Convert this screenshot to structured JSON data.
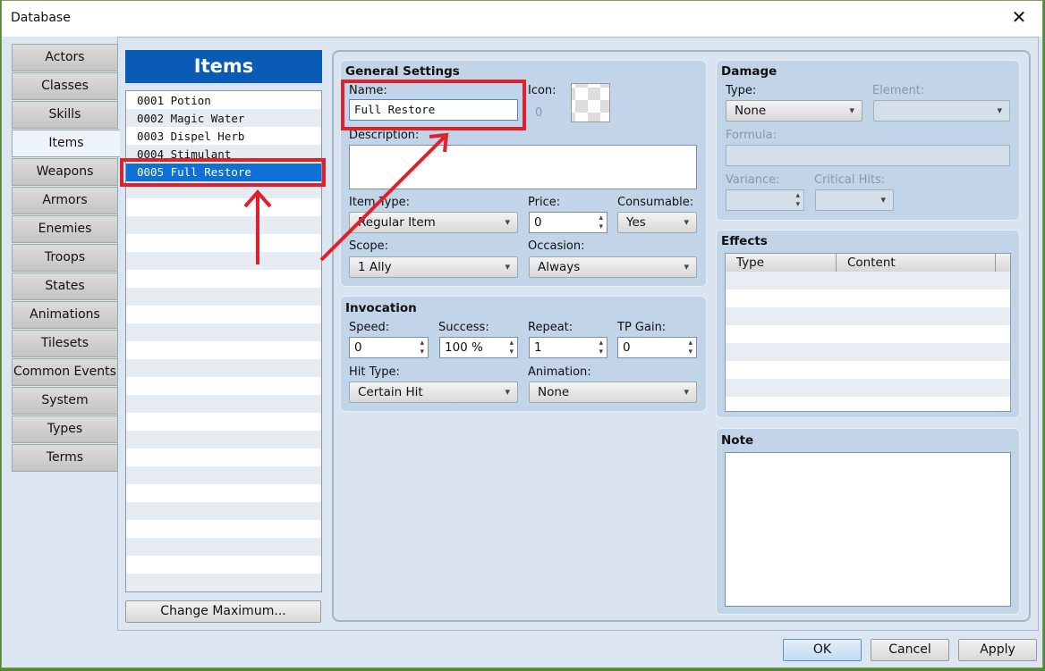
{
  "window": {
    "title": "Database",
    "close_icon": "close-icon"
  },
  "tabs": [
    "Actors",
    "Classes",
    "Skills",
    "Items",
    "Weapons",
    "Armors",
    "Enemies",
    "Troops",
    "States",
    "Animations",
    "Tilesets",
    "Common Events",
    "System",
    "Types",
    "Terms"
  ],
  "selected_tab": "Items",
  "list": {
    "title": "Items",
    "items": [
      "0001 Potion",
      "0002 Magic Water",
      "0003 Dispel Herb",
      "0004 Stimulant",
      "0005 Full Restore"
    ],
    "selected": 4,
    "change_max": "Change Maximum..."
  },
  "general": {
    "title": "General Settings",
    "name_label": "Name:",
    "name_value": "Full Restore",
    "icon_label": "Icon:",
    "icon_index": "0",
    "desc_label": "Description:",
    "item_type_label": "Item Type:",
    "item_type": "Regular Item",
    "price_label": "Price:",
    "price": "0",
    "consumable_label": "Consumable:",
    "consumable": "Yes",
    "scope_label": "Scope:",
    "scope": "1 Ally",
    "occasion_label": "Occasion:",
    "occasion": "Always"
  },
  "invocation": {
    "title": "Invocation",
    "speed_label": "Speed:",
    "speed": "0",
    "success_label": "Success:",
    "success": "100 %",
    "repeat_label": "Repeat:",
    "repeat": "1",
    "tp_label": "TP Gain:",
    "tp": "0",
    "hit_type_label": "Hit Type:",
    "hit_type": "Certain Hit",
    "animation_label": "Animation:",
    "animation": "None"
  },
  "damage": {
    "title": "Damage",
    "type_label": "Type:",
    "type": "None",
    "element_label": "Element:",
    "formula_label": "Formula:",
    "variance_label": "Variance:",
    "critical_label": "Critical Hits:"
  },
  "effects": {
    "title": "Effects",
    "col_type": "Type",
    "col_content": "Content"
  },
  "note": {
    "title": "Note"
  },
  "buttons": {
    "ok": "OK",
    "cancel": "Cancel",
    "apply": "Apply"
  },
  "annotation_color": "#e0202a"
}
